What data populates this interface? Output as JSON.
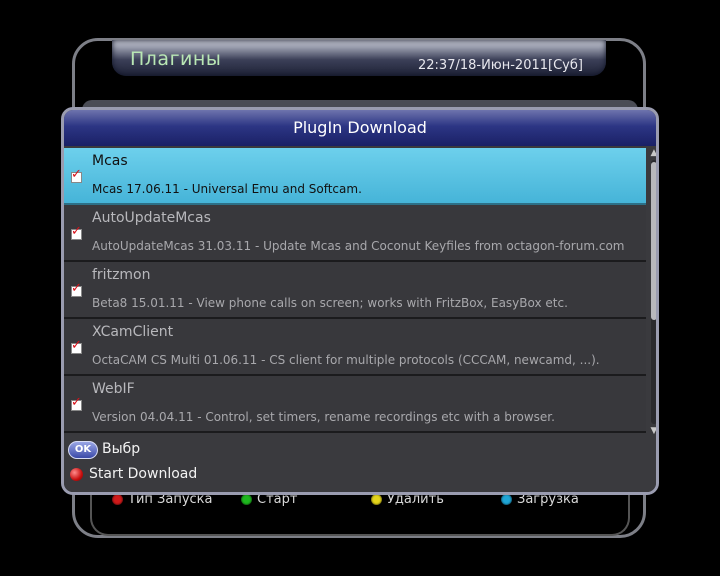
{
  "background_screen": {
    "title": "Плагины",
    "clock": "22:37/18-Июн-2011[Суб]",
    "keys": [
      {
        "label": "Тип Запуска",
        "color": "#d01a1a"
      },
      {
        "label": "Старт",
        "color": "#1eb81e"
      },
      {
        "label": "Удалить",
        "color": "#e5d51a"
      },
      {
        "label": "Загрузка",
        "color": "#1fa6d6"
      }
    ]
  },
  "dialog": {
    "title": "PlugIn Download",
    "items": [
      {
        "name": "Mcas",
        "description": "Mcas 17.06.11 - Universal Emu and Softcam.",
        "checked": true,
        "selected": true
      },
      {
        "name": "AutoUpdateMcas",
        "description": "AutoUpdateMcas 31.03.11 - Update Mcas and Coconut Keyfiles from octagon-forum.com",
        "checked": true,
        "selected": false
      },
      {
        "name": "fritzmon",
        "description": "Beta8 15.01.11 - View phone calls on screen; works  with FritzBox, EasyBox etc.",
        "checked": true,
        "selected": false
      },
      {
        "name": "XCamClient",
        "description": "OctaCAM CS Multi 01.06.11 - CS client for multiple protocols (CCCAM, newcamd, ...).",
        "checked": true,
        "selected": false
      },
      {
        "name": "WebIF",
        "description": "Version 04.04.11 - Control, set timers, rename recordings etc with a browser.",
        "checked": true,
        "selected": false
      }
    ],
    "check_glyph": "✓",
    "scroll": {
      "up": "▲",
      "down": "▼"
    },
    "footer": {
      "ok_button": "OK",
      "ok_label": "Выбр",
      "red_label": "Start Download"
    }
  },
  "colors": {
    "selection": "#55c1e2",
    "title_bar": "#2c3584",
    "red_key": "#c80f0f"
  }
}
